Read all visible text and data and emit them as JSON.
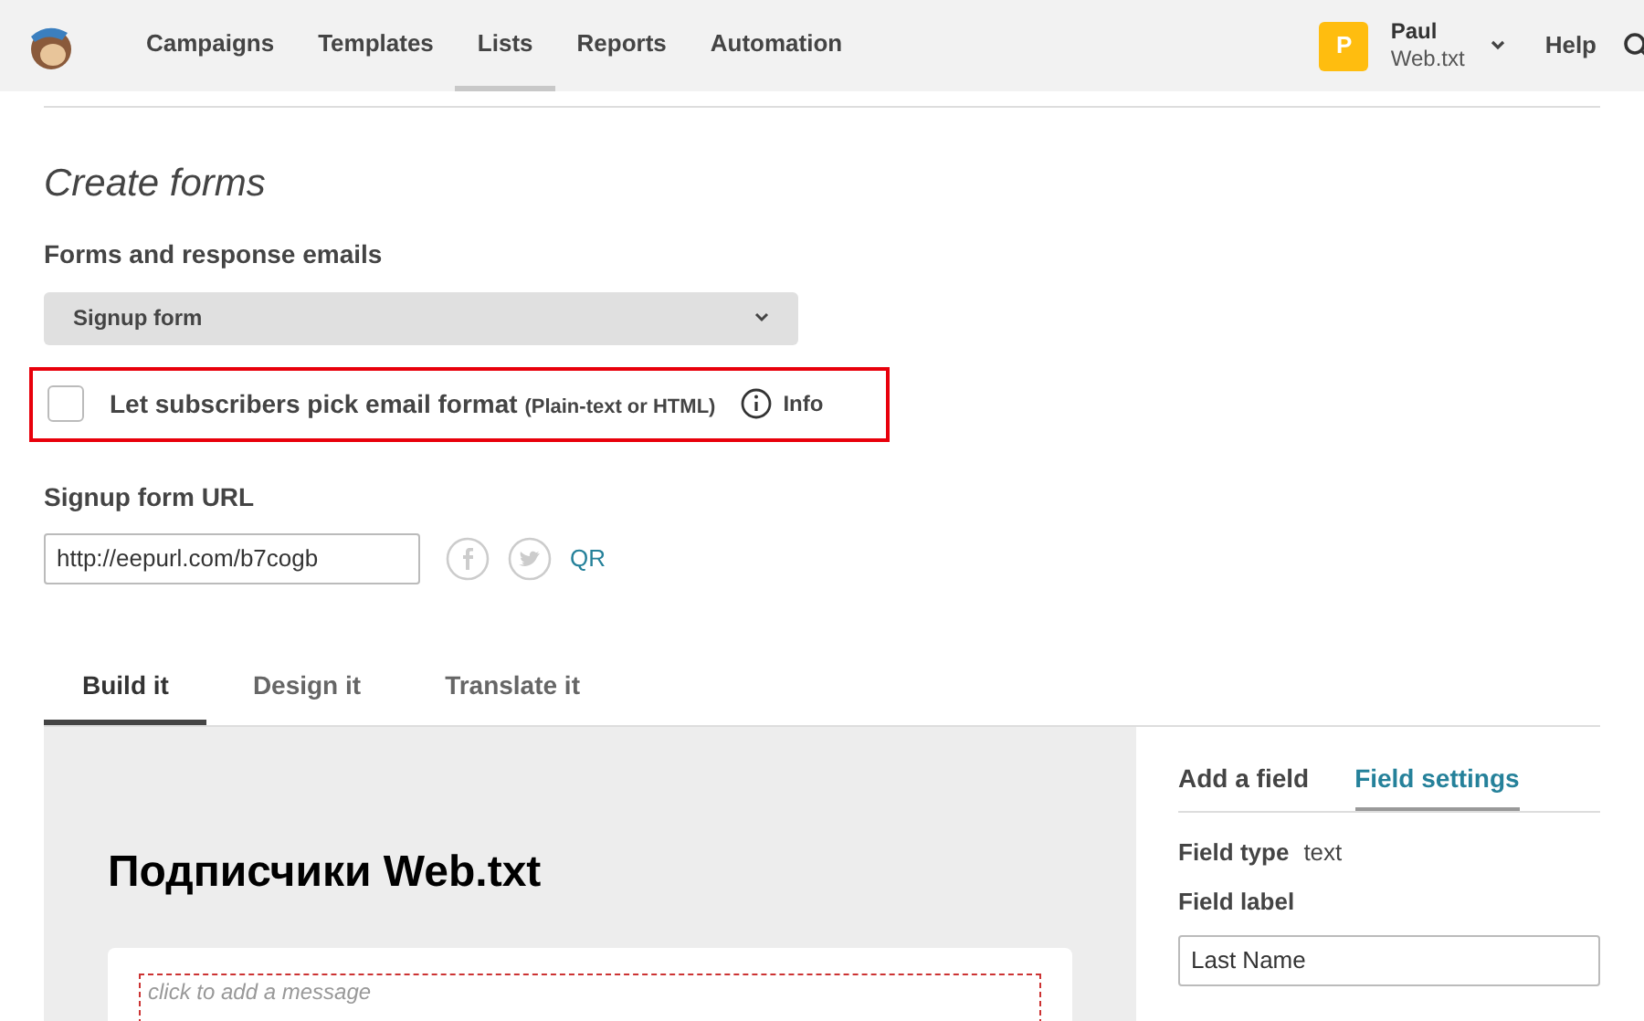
{
  "nav": {
    "items": [
      {
        "label": "Campaigns",
        "selected": false
      },
      {
        "label": "Templates",
        "selected": false
      },
      {
        "label": "Lists",
        "selected": true
      },
      {
        "label": "Reports",
        "selected": false
      },
      {
        "label": "Automation",
        "selected": false
      }
    ],
    "avatar": "P",
    "user_name": "Paul",
    "account": "Web.txt",
    "help": "Help"
  },
  "page_title": "Create forms",
  "forms_label": "Forms and response emails",
  "form_select": "Signup form",
  "format_option": {
    "label": "Let subscribers pick email format",
    "note": "(Plain-text or HTML)",
    "checked": false,
    "info": "Info"
  },
  "url_label": "Signup form URL",
  "url_value": "http://eepurl.com/b7cogb",
  "qr": "QR",
  "tabs": [
    {
      "label": "Build it",
      "selected": true
    },
    {
      "label": "Design it",
      "selected": false
    },
    {
      "label": "Translate it",
      "selected": false
    }
  ],
  "preview": {
    "title": "Подписчики Web.txt",
    "message_placeholder": "click to add a message"
  },
  "side_tabs": [
    {
      "label": "Add a field",
      "selected": false
    },
    {
      "label": "Field settings",
      "selected": true
    }
  ],
  "field_type_label": "Field type",
  "field_type": "text",
  "field_label_label": "Field label",
  "field_label_value": "Last Name"
}
